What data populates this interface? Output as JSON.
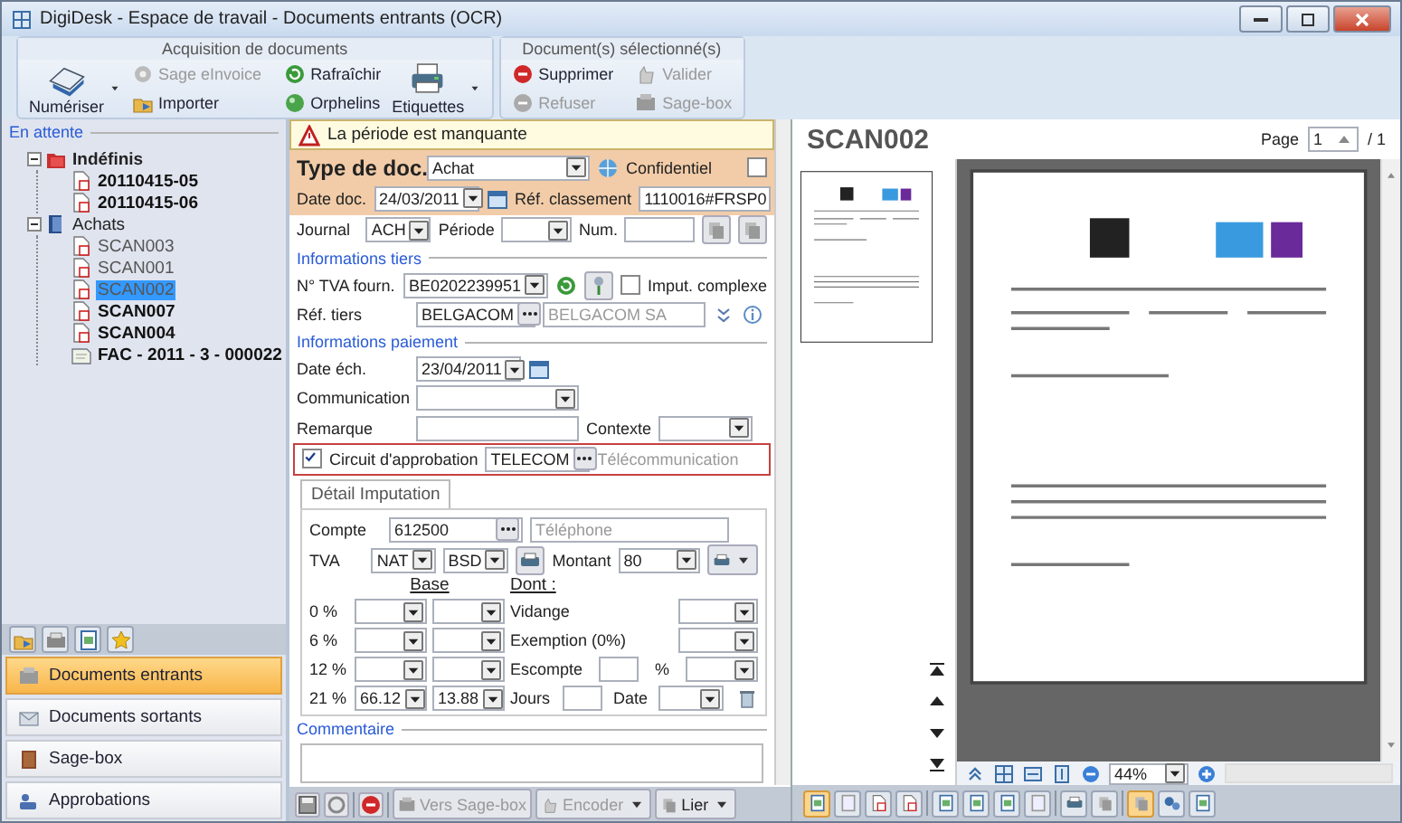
{
  "window": {
    "title": "DigiDesk - Espace de travail  - Documents entrants (OCR)"
  },
  "ribbon": [
    {
      "title": "Acquisition de documents",
      "items": [
        {
          "label": "Numériser",
          "kind": "large",
          "disabled": false
        },
        {
          "label": "Sage eInvoice",
          "kind": "small",
          "disabled": true
        },
        {
          "label": "Importer",
          "kind": "small",
          "disabled": false
        },
        {
          "label": "Rafraîchir",
          "kind": "small",
          "disabled": false
        },
        {
          "label": "Orphelins",
          "kind": "small",
          "disabled": false
        },
        {
          "label": "Etiquettes",
          "kind": "large",
          "disabled": false
        }
      ]
    },
    {
      "title": "Document(s) sélectionné(s)",
      "items": [
        {
          "label": "Supprimer",
          "kind": "small",
          "disabled": false
        },
        {
          "label": "Refuser",
          "kind": "small",
          "disabled": true
        },
        {
          "label": "Valider",
          "kind": "small",
          "disabled": true
        },
        {
          "label": "Sage-box",
          "kind": "small",
          "disabled": true
        }
      ]
    }
  ],
  "tree": {
    "title": "En attente",
    "items": [
      {
        "label": "Indéfinis",
        "kind": "folder",
        "bold": true,
        "selected": false,
        "expanded": true,
        "children": [
          {
            "label": "20110415-05",
            "kind": "document",
            "bold": true,
            "selected": false
          },
          {
            "label": "20110415-06",
            "kind": "document",
            "bold": true,
            "selected": false
          }
        ]
      },
      {
        "label": "Achats",
        "kind": "folder",
        "bold": false,
        "selected": false,
        "expanded": true,
        "children": [
          {
            "label": "SCAN003",
            "kind": "document",
            "bold": false,
            "selected": false
          },
          {
            "label": "SCAN001",
            "kind": "document",
            "bold": false,
            "selected": false
          },
          {
            "label": "SCAN002",
            "kind": "document",
            "bold": false,
            "selected": true
          },
          {
            "label": "SCAN007",
            "kind": "document",
            "bold": true,
            "selected": false
          },
          {
            "label": "SCAN004",
            "kind": "document",
            "bold": true,
            "selected": false
          },
          {
            "label": "FAC - 2011 - 3 - 000022",
            "kind": "invoice",
            "bold": true,
            "selected": false
          }
        ]
      }
    ]
  },
  "nav": {
    "items": [
      {
        "label": "Documents entrants",
        "selected": true
      },
      {
        "label": "Documents sortants",
        "selected": false
      },
      {
        "label": "Sage-box",
        "selected": false
      },
      {
        "label": "Approbations",
        "selected": false
      }
    ]
  },
  "form": {
    "warning": "La période est manquante",
    "type_label": "Type de doc.",
    "type_value": "Achat",
    "confidential_label": "Confidentiel",
    "confidential_checked": false,
    "date_label": "Date doc.",
    "date_value": "24/03/2011",
    "ref_label": "Réf. classement",
    "ref_value": "1110016#FRSP0",
    "journal_label": "Journal",
    "journal_value": "ACH",
    "period_label": "Période",
    "num_label": "Num.",
    "tiers": {
      "title": "Informations tiers",
      "vat_label": "N° TVA fourn.",
      "vat_value": "BE0202239951",
      "complex_label": "Imput. complexe",
      "complex_checked": false,
      "ref_label": "Réf. tiers",
      "ref_value": "BELGACOM",
      "name_value": "BELGACOM SA"
    },
    "payment": {
      "title": "Informations paiement",
      "due_label": "Date éch.",
      "due_value": "23/04/2011",
      "comm_label": "Communication",
      "remark_label": "Remarque",
      "context_label": "Contexte"
    },
    "approval": {
      "label": "Circuit d'approbation",
      "checked": true,
      "highlighted": true,
      "code": "TELECOM",
      "description": "Télécommunication"
    },
    "imputation": {
      "tab": "Détail Imputation",
      "account_label": "Compte",
      "account_value": "612500",
      "account_name": "Téléphone",
      "vat_label": "TVA",
      "vat_code": "NAT",
      "vat_type": "BSD",
      "amount_label": "Montant",
      "amount_value": "80",
      "base_header": "Base",
      "dont_header": "Dont :",
      "rates": [
        {
          "label": "0 %"
        },
        {
          "label": "6 %"
        },
        {
          "label": "12 %"
        },
        {
          "label": "21 %",
          "base": "66.12",
          "vat": "13.88"
        }
      ],
      "side": [
        {
          "kind": "select",
          "label": "Vidange"
        },
        {
          "kind": "select",
          "label": "Exemption (0%)"
        },
        {
          "kind": "discount",
          "label": "Escompte",
          "unit": "%"
        },
        {
          "kind": "terms",
          "label": "Jours",
          "date_label": "Date"
        }
      ]
    },
    "comment_title": "Commentaire",
    "actions": [
      {
        "label": "Vers Sage-box",
        "disabled": true,
        "dropdown": false
      },
      {
        "label": "Encoder",
        "disabled": true,
        "dropdown": true
      },
      {
        "label": "Lier",
        "disabled": false,
        "dropdown": true
      }
    ]
  },
  "viewer": {
    "title": "SCAN002",
    "page_label": "Page",
    "page_value": "1",
    "page_total": "/ 1",
    "zoom": "44%"
  }
}
